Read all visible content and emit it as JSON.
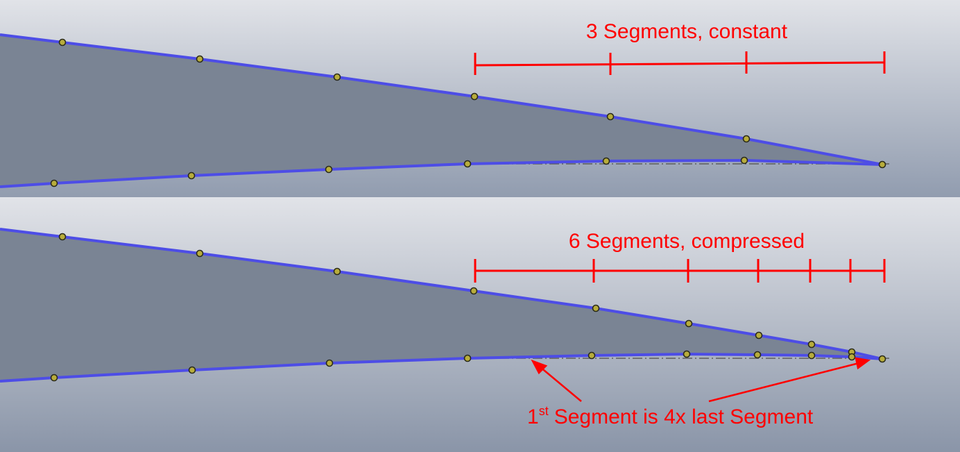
{
  "panels": [
    {
      "title": "3 Segments, constant",
      "segment_count": 3,
      "distribution": "constant"
    },
    {
      "title": "6 Segments, compressed",
      "segment_count": 6,
      "distribution": "compressed"
    }
  ],
  "annotation": {
    "ordinal": "1",
    "ordinal_suffix": "st",
    "text": "Segment is 4x last Segment"
  },
  "colors": {
    "profile_line": "#4d4de6",
    "annotation": "#ff0000",
    "point_fill": "#b8ad3c",
    "fill_area": "#7a8494"
  }
}
